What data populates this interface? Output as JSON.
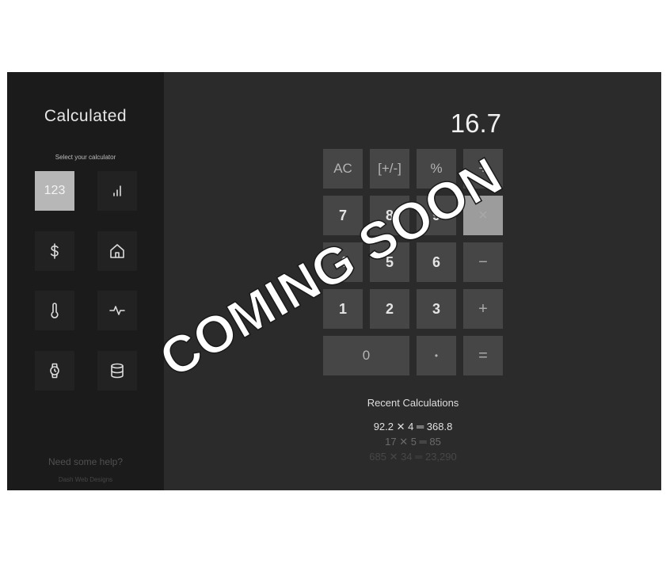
{
  "sidebar": {
    "title": "Calculated",
    "select_label": "Select your calculator",
    "calculators": [
      {
        "label": "123",
        "icon": "numeric-calculator",
        "active": true
      },
      {
        "label": "",
        "icon": "bar-chart-icon"
      },
      {
        "label": "",
        "icon": "dollar-icon"
      },
      {
        "label": "",
        "icon": "home-icon"
      },
      {
        "label": "",
        "icon": "thermometer-icon"
      },
      {
        "label": "",
        "icon": "pulse-icon"
      },
      {
        "label": "",
        "icon": "watch-icon"
      },
      {
        "label": "",
        "icon": "database-icon"
      }
    ],
    "help_text": "Need some help?",
    "credit": "Dash Web Designs"
  },
  "calculator": {
    "display": "16.7",
    "keys": {
      "ac": "AC",
      "sign": "[+/-]",
      "percent": "%",
      "divide": "÷",
      "seven": "7",
      "eight": "8",
      "nine": "9",
      "multiply": "×",
      "four": "4",
      "five": "5",
      "six": "6",
      "minus": "−",
      "one": "1",
      "two": "2",
      "three": "3",
      "plus": "+",
      "zero": "0",
      "decimal": "•",
      "equals": "="
    }
  },
  "recent": {
    "title": "Recent Calculations",
    "items": [
      "92.2 ✕ 4 ═ 368.8",
      "17 ✕ 5 ═ 85",
      "685 ✕ 34 ═ 23,290"
    ]
  },
  "watermark": {
    "text": "COMING SOON",
    "color": "#ffffff"
  }
}
